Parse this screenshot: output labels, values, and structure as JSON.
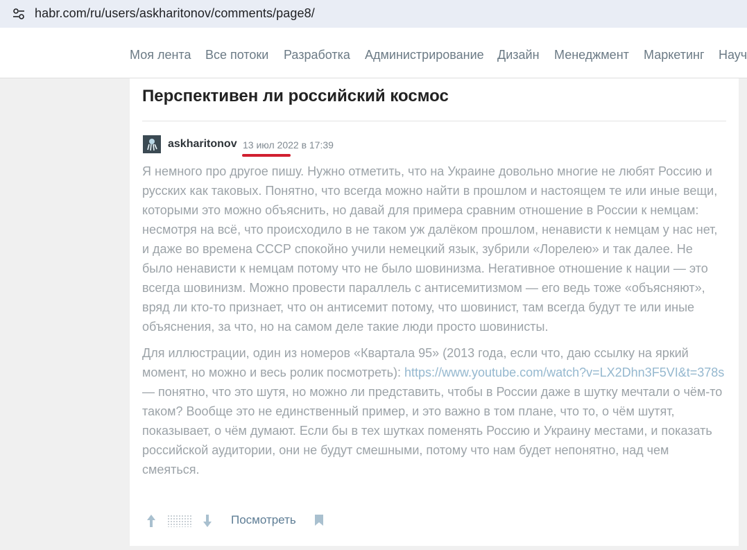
{
  "browser": {
    "url": "habr.com/ru/users/askharitonov/comments/page8/"
  },
  "nav": {
    "items": [
      "Моя лента",
      "Все потоки",
      "Разработка",
      "Администрирование",
      "Дизайн",
      "Менеджмент",
      "Маркетинг",
      "Науч"
    ]
  },
  "post": {
    "title": "Перспективен ли российский космос"
  },
  "comment": {
    "author": "askharitonov",
    "datetime": "13 июл 2022 в 17:39",
    "paragraph1": "Я немного про другое пишу. Нужно отметить, что на Украине довольно многие не любят Россию и русских как таковых. Понятно, что всегда можно найти в прошлом и настоящем те или иные вещи, которыми это можно объяснить, но давай для примера сравним отношение в России к немцам: несмотря на всё, что происходило в не таком уж далёком прошлом, ненависти к немцам у нас нет, и даже во времена СССР спокойно учили немецкий язык, зубрили «Лорелею» и так далее. Не было ненависти к немцам потому что не было шовинизма. Негативное отношение к нации — это всегда шовинизм. Можно провести параллель с антисемитизмом — его ведь тоже «объясняют», вряд ли кто-то признает, что он антисемит потому, что шовинист, там всегда будут те или иные объяснения, за что, но на самом деле такие люди просто шовинисты.",
    "paragraph2_before": "Для иллюстрации, один из номеров «Квартала 95» (2013 года, если что, даю ссылку на яркий момент, но можно и весь ролик посмотреть): ",
    "paragraph2_link": "https://www.youtube.com/watch?v=LX2Dhn3F5VI&t=378s",
    "paragraph2_after": " — понятно, что это шутя, но можно ли представить, чтобы в России даже в шутку мечтали о чём-то таком? Вообще это не единственный пример, и это важно в том плане, что то, о чём шутят, показывает, о чём думают. Если бы в тех шутках поменять Россию и Украину местами, и показать российской аудитории, они не будут смешными, потому что нам будет непонятно, над чем смеяться."
  },
  "actions": {
    "view_label": "Посмотреть"
  },
  "icons": {
    "site_settings": "site-settings-icon",
    "upvote": "arrow-up-icon",
    "downvote": "arrow-down-icon",
    "bookmark": "bookmark-icon"
  },
  "colors": {
    "nav_text": "#6b7a85",
    "link": "#95b8cf",
    "annotation_underline": "#d12030"
  }
}
